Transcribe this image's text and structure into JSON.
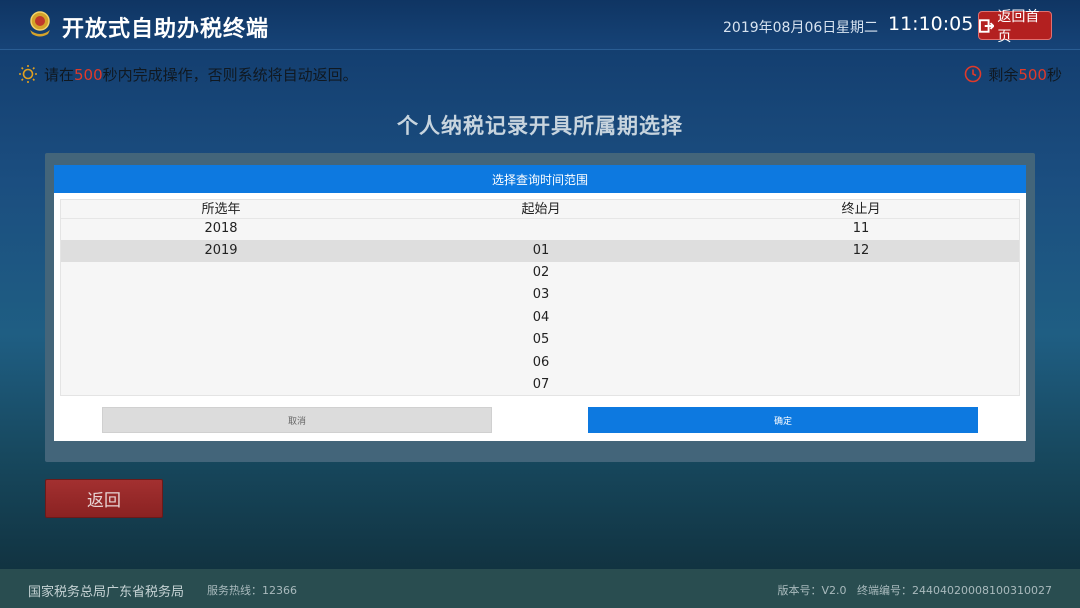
{
  "header": {
    "title": "开放式自助办税终端",
    "date": "2019年08月06日",
    "weekday": "星期二",
    "time": "11:10:05",
    "home_button": "返回首页"
  },
  "notice": {
    "prefix": "请在",
    "seconds": "500",
    "suffix": "秒内完成操作，否则系统将自动返回。",
    "remain_prefix": "剩余",
    "remain_seconds": "500",
    "remain_suffix": "秒"
  },
  "page_title": "个人纳税记录开具所属期选择",
  "dialog": {
    "header": "选择查询时间范围",
    "columns": {
      "year": "所选年",
      "start_month": "起始月",
      "end_month": "终止月"
    },
    "years": [
      "2018",
      "2019"
    ],
    "start_months": [
      "01",
      "02",
      "03",
      "04",
      "05",
      "06",
      "07"
    ],
    "end_months": [
      "11",
      "12"
    ],
    "cancel_label": "取消",
    "confirm_label": "确定"
  },
  "back_button": "返回",
  "footer": {
    "org": "国家税务总局广东省税务局",
    "hotline": "服务热线：12366",
    "version": "版本号：V2.0",
    "terminal": "终端编号：24404020008100310027"
  },
  "colors": {
    "accent_blue": "#0d79e0",
    "alert_red": "#b32020",
    "highlight_red": "#e03a2a"
  }
}
